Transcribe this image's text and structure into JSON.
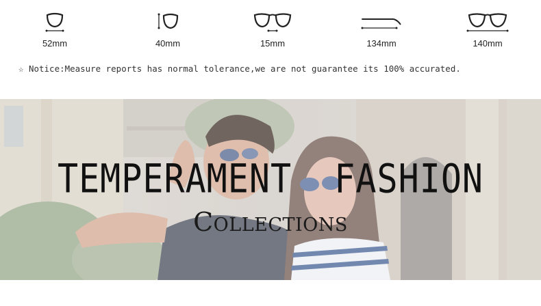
{
  "measurements": [
    {
      "icon": "lens-width-icon",
      "value": "52mm"
    },
    {
      "icon": "lens-height-icon",
      "value": "40mm"
    },
    {
      "icon": "bridge-width-icon",
      "value": "15mm"
    },
    {
      "icon": "temple-length-icon",
      "value": "134mm"
    },
    {
      "icon": "frame-width-icon",
      "value": "140mm"
    }
  ],
  "notice": "☆ Notice:Measure reports has normal tolerance,we are not guarantee its 100% accurated.",
  "banner": {
    "headline": "TEMPERAMENT  FASHION",
    "subline": "Collections"
  }
}
